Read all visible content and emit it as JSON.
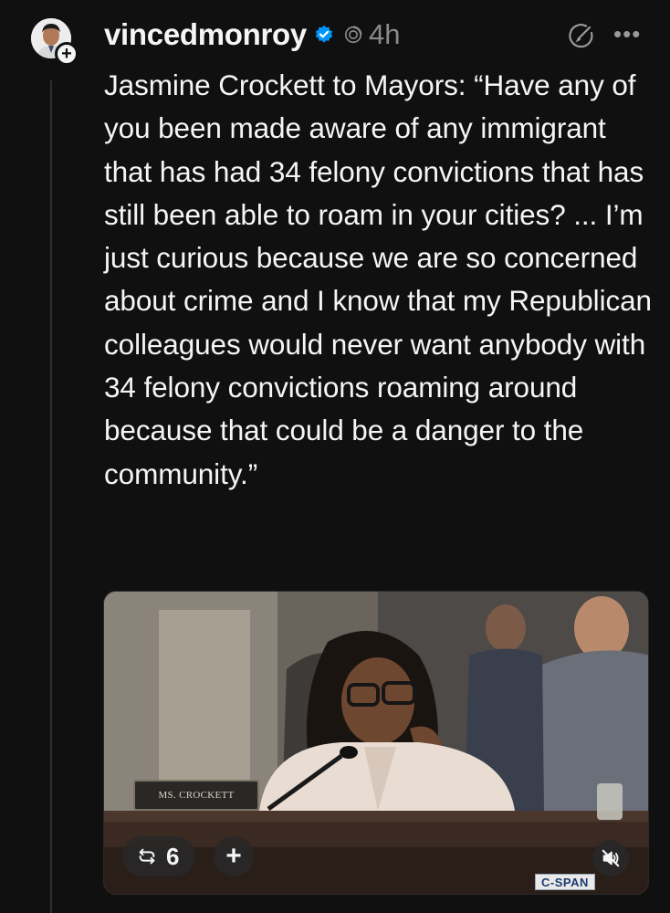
{
  "post": {
    "username": "vincedmonroy",
    "timestamp": "4h",
    "text": "Jasmine Crockett to Mayors: “Have any of you been made aware of any immigrant that has had 34 felony convictions that has still been able to roam in your cities? ... I’m just curious because we are so concerned about crime and I know that my Republican colleagues would never want anybody with 34 felony convictions roaming around because that could be a danger to the community.”",
    "icons": {
      "avatar": "avatar-icon",
      "follow": "plus-icon",
      "verified": "verified-badge-icon",
      "ai": "threads-ai-icon",
      "edit": "edit-icon",
      "more": "more-icon"
    }
  },
  "media": {
    "nameplate": "MS. CROCKETT",
    "repost_count": "6",
    "add_label": "+",
    "watermark": "C-SPAN",
    "icons": {
      "repost": "repost-icon",
      "mute": "muted-speaker-icon"
    }
  },
  "colors": {
    "background": "#101010",
    "text": "#f3f5f7",
    "muted": "#8a8a8a",
    "verified": "#0095f6"
  }
}
